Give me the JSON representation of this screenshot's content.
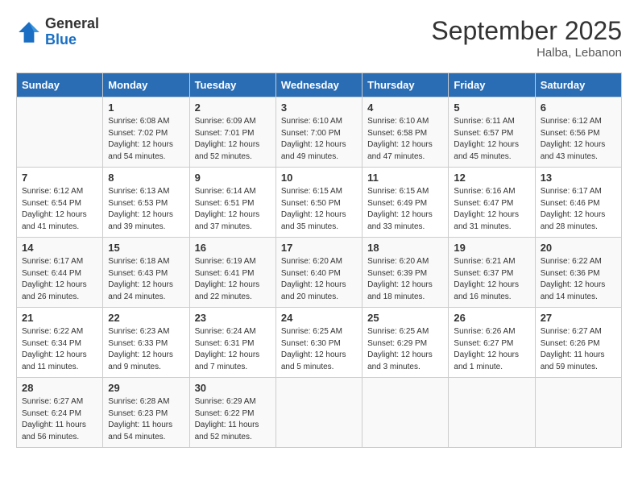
{
  "header": {
    "logo_general": "General",
    "logo_blue": "Blue",
    "month_title": "September 2025",
    "location": "Halba, Lebanon"
  },
  "weekdays": [
    "Sunday",
    "Monday",
    "Tuesday",
    "Wednesday",
    "Thursday",
    "Friday",
    "Saturday"
  ],
  "weeks": [
    [
      {
        "day": "",
        "text": ""
      },
      {
        "day": "1",
        "text": "Sunrise: 6:08 AM\nSunset: 7:02 PM\nDaylight: 12 hours\nand 54 minutes."
      },
      {
        "day": "2",
        "text": "Sunrise: 6:09 AM\nSunset: 7:01 PM\nDaylight: 12 hours\nand 52 minutes."
      },
      {
        "day": "3",
        "text": "Sunrise: 6:10 AM\nSunset: 7:00 PM\nDaylight: 12 hours\nand 49 minutes."
      },
      {
        "day": "4",
        "text": "Sunrise: 6:10 AM\nSunset: 6:58 PM\nDaylight: 12 hours\nand 47 minutes."
      },
      {
        "day": "5",
        "text": "Sunrise: 6:11 AM\nSunset: 6:57 PM\nDaylight: 12 hours\nand 45 minutes."
      },
      {
        "day": "6",
        "text": "Sunrise: 6:12 AM\nSunset: 6:56 PM\nDaylight: 12 hours\nand 43 minutes."
      }
    ],
    [
      {
        "day": "7",
        "text": "Sunrise: 6:12 AM\nSunset: 6:54 PM\nDaylight: 12 hours\nand 41 minutes."
      },
      {
        "day": "8",
        "text": "Sunrise: 6:13 AM\nSunset: 6:53 PM\nDaylight: 12 hours\nand 39 minutes."
      },
      {
        "day": "9",
        "text": "Sunrise: 6:14 AM\nSunset: 6:51 PM\nDaylight: 12 hours\nand 37 minutes."
      },
      {
        "day": "10",
        "text": "Sunrise: 6:15 AM\nSunset: 6:50 PM\nDaylight: 12 hours\nand 35 minutes."
      },
      {
        "day": "11",
        "text": "Sunrise: 6:15 AM\nSunset: 6:49 PM\nDaylight: 12 hours\nand 33 minutes."
      },
      {
        "day": "12",
        "text": "Sunrise: 6:16 AM\nSunset: 6:47 PM\nDaylight: 12 hours\nand 31 minutes."
      },
      {
        "day": "13",
        "text": "Sunrise: 6:17 AM\nSunset: 6:46 PM\nDaylight: 12 hours\nand 28 minutes."
      }
    ],
    [
      {
        "day": "14",
        "text": "Sunrise: 6:17 AM\nSunset: 6:44 PM\nDaylight: 12 hours\nand 26 minutes."
      },
      {
        "day": "15",
        "text": "Sunrise: 6:18 AM\nSunset: 6:43 PM\nDaylight: 12 hours\nand 24 minutes."
      },
      {
        "day": "16",
        "text": "Sunrise: 6:19 AM\nSunset: 6:41 PM\nDaylight: 12 hours\nand 22 minutes."
      },
      {
        "day": "17",
        "text": "Sunrise: 6:20 AM\nSunset: 6:40 PM\nDaylight: 12 hours\nand 20 minutes."
      },
      {
        "day": "18",
        "text": "Sunrise: 6:20 AM\nSunset: 6:39 PM\nDaylight: 12 hours\nand 18 minutes."
      },
      {
        "day": "19",
        "text": "Sunrise: 6:21 AM\nSunset: 6:37 PM\nDaylight: 12 hours\nand 16 minutes."
      },
      {
        "day": "20",
        "text": "Sunrise: 6:22 AM\nSunset: 6:36 PM\nDaylight: 12 hours\nand 14 minutes."
      }
    ],
    [
      {
        "day": "21",
        "text": "Sunrise: 6:22 AM\nSunset: 6:34 PM\nDaylight: 12 hours\nand 11 minutes."
      },
      {
        "day": "22",
        "text": "Sunrise: 6:23 AM\nSunset: 6:33 PM\nDaylight: 12 hours\nand 9 minutes."
      },
      {
        "day": "23",
        "text": "Sunrise: 6:24 AM\nSunset: 6:31 PM\nDaylight: 12 hours\nand 7 minutes."
      },
      {
        "day": "24",
        "text": "Sunrise: 6:25 AM\nSunset: 6:30 PM\nDaylight: 12 hours\nand 5 minutes."
      },
      {
        "day": "25",
        "text": "Sunrise: 6:25 AM\nSunset: 6:29 PM\nDaylight: 12 hours\nand 3 minutes."
      },
      {
        "day": "26",
        "text": "Sunrise: 6:26 AM\nSunset: 6:27 PM\nDaylight: 12 hours\nand 1 minute."
      },
      {
        "day": "27",
        "text": "Sunrise: 6:27 AM\nSunset: 6:26 PM\nDaylight: 11 hours\nand 59 minutes."
      }
    ],
    [
      {
        "day": "28",
        "text": "Sunrise: 6:27 AM\nSunset: 6:24 PM\nDaylight: 11 hours\nand 56 minutes."
      },
      {
        "day": "29",
        "text": "Sunrise: 6:28 AM\nSunset: 6:23 PM\nDaylight: 11 hours\nand 54 minutes."
      },
      {
        "day": "30",
        "text": "Sunrise: 6:29 AM\nSunset: 6:22 PM\nDaylight: 11 hours\nand 52 minutes."
      },
      {
        "day": "",
        "text": ""
      },
      {
        "day": "",
        "text": ""
      },
      {
        "day": "",
        "text": ""
      },
      {
        "day": "",
        "text": ""
      }
    ]
  ]
}
